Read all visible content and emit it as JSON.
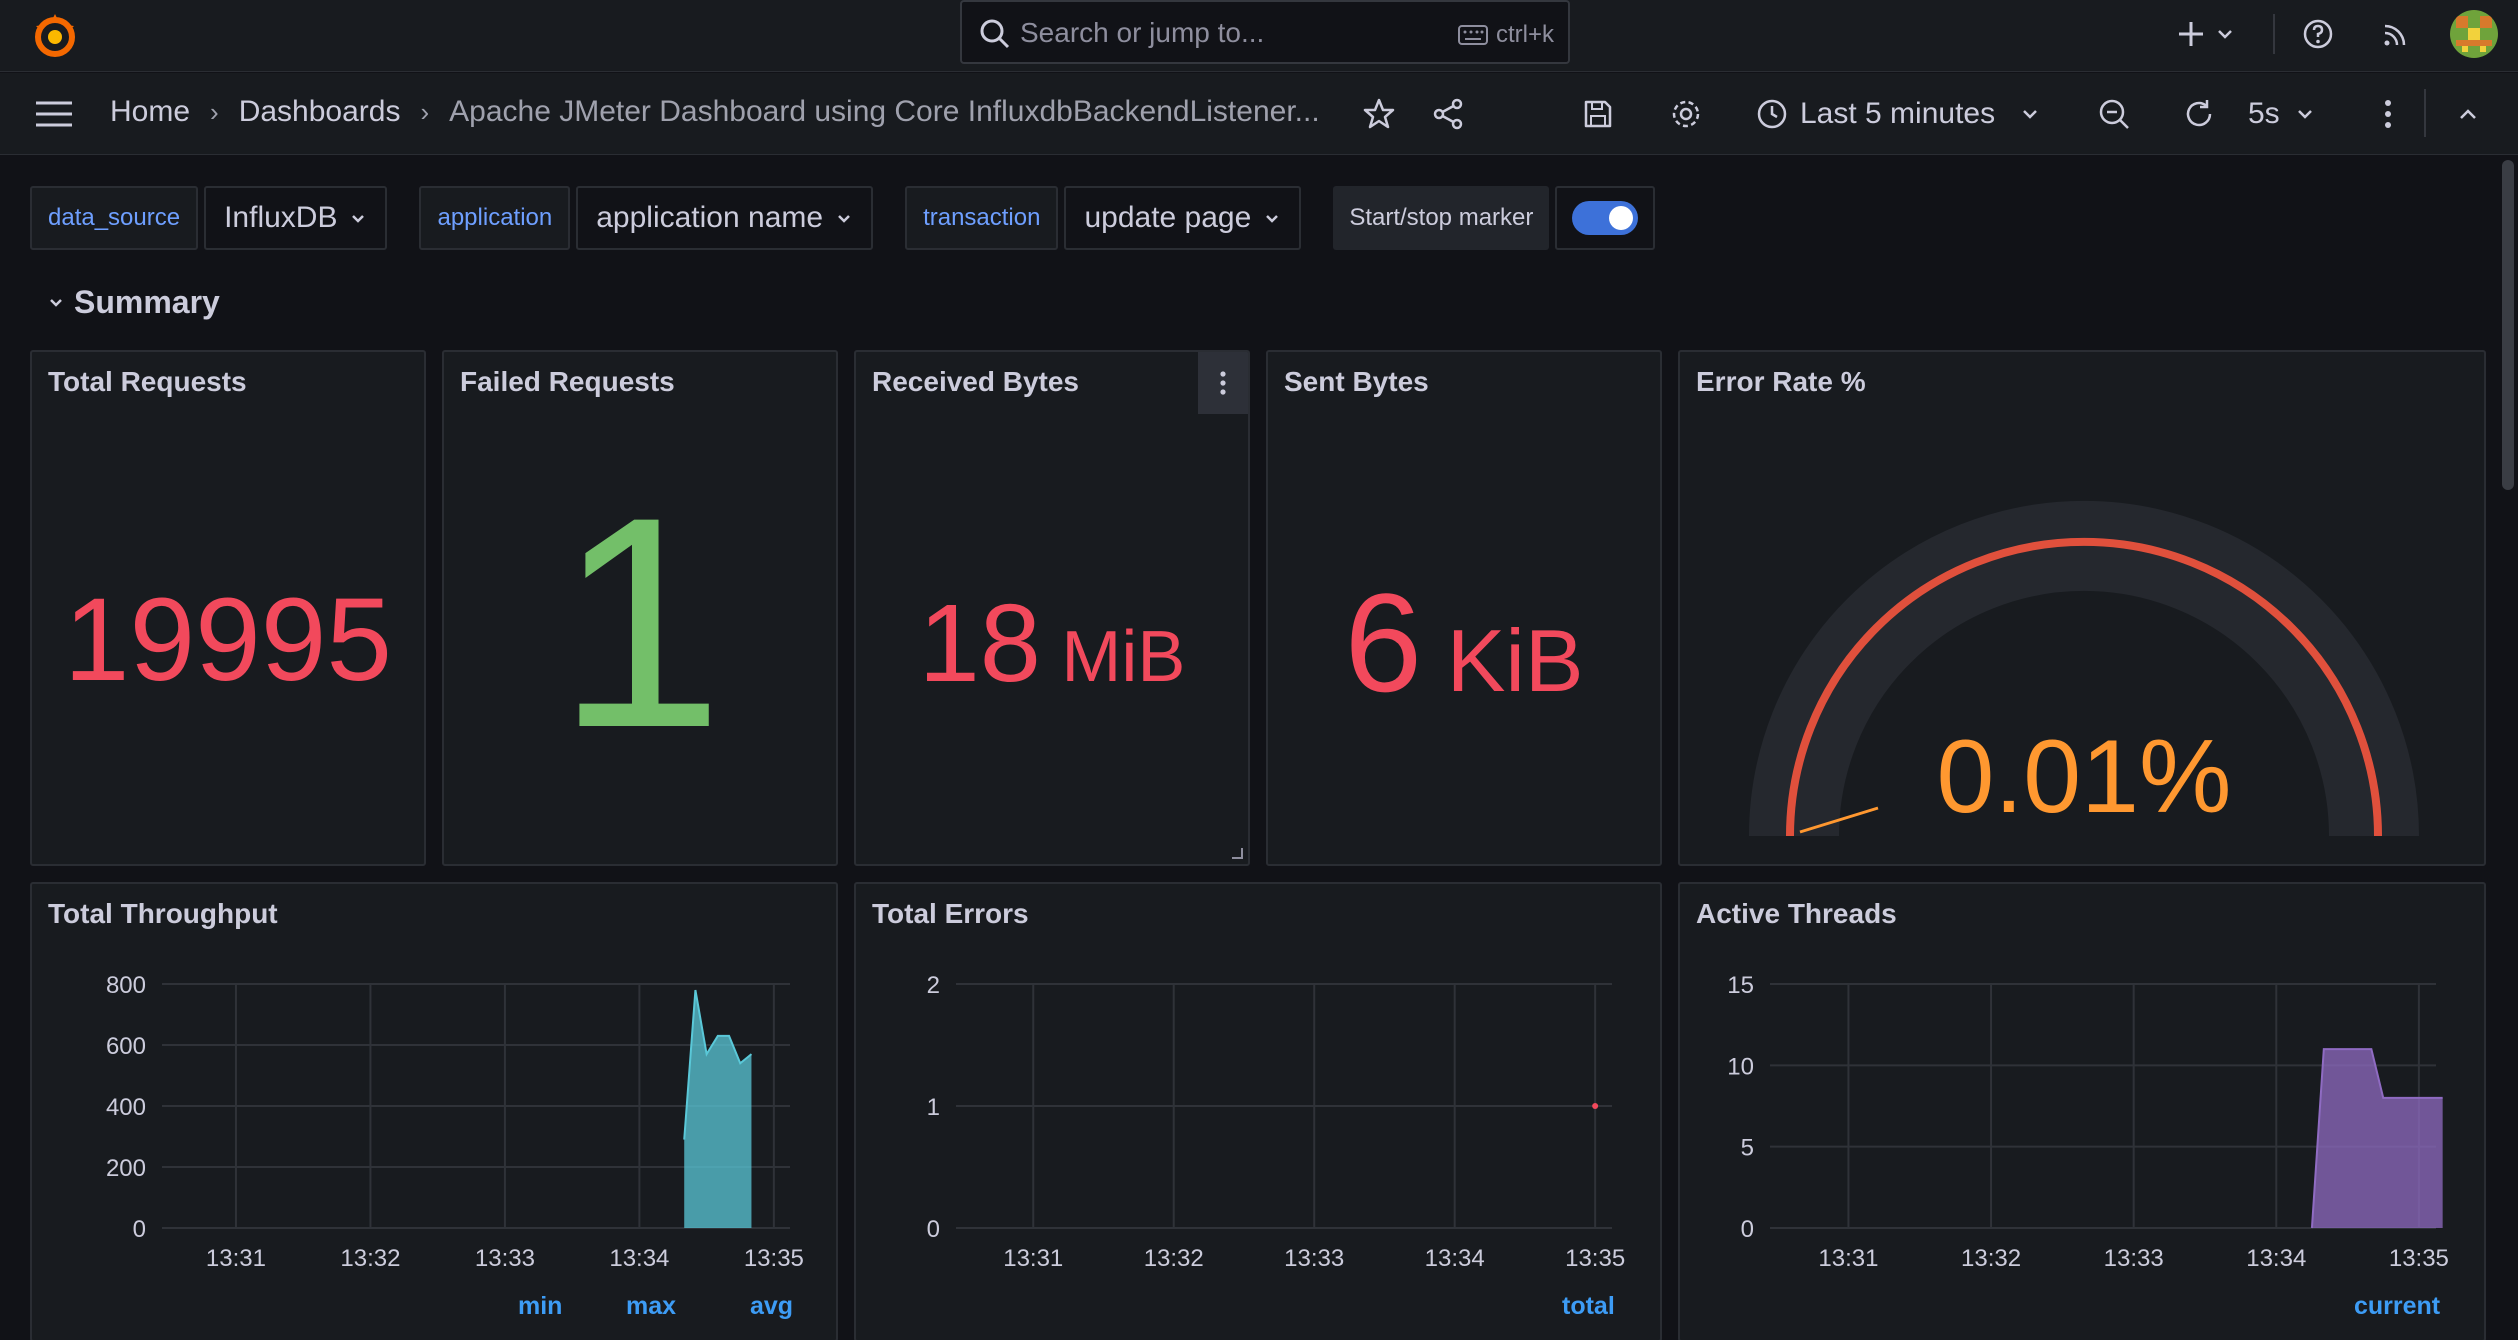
{
  "topbar": {
    "search_placeholder": "Search or jump to...",
    "search_shortcut": "ctrl+k",
    "icons": [
      "grafana-logo-icon",
      "search-icon",
      "keyboard-icon",
      "plus-icon",
      "help-icon",
      "news-icon",
      "avatar"
    ]
  },
  "nav": {
    "breadcrumbs": [
      "Home",
      "Dashboards",
      "Apache JMeter Dashboard using Core InfluxdbBackendListener..."
    ],
    "time_range": "Last 5 minutes",
    "refresh_interval": "5s"
  },
  "variables": {
    "data_source_label": "data_source",
    "data_source_value": "InfluxDB",
    "application_label": "application",
    "application_value": "application name",
    "transaction_label": "transaction",
    "transaction_value": "update page",
    "marker_label": "Start/stop marker",
    "marker_enabled": true
  },
  "row": {
    "title": "Summary"
  },
  "panels": {
    "total_requests": {
      "title": "Total Requests",
      "value": "19995",
      "color": "#f2495c"
    },
    "failed_requests": {
      "title": "Failed Requests",
      "value": "1",
      "color": "#73bf69"
    },
    "received_bytes": {
      "title": "Received Bytes",
      "value": "18",
      "unit": "MiB",
      "color": "#f2495c"
    },
    "sent_bytes": {
      "title": "Sent Bytes",
      "value": "6",
      "unit": "KiB",
      "color": "#f2495c"
    },
    "error_rate": {
      "title": "Error Rate %",
      "value": "0.01%",
      "color": "#ff9830",
      "gauge_color": "#f2495c"
    },
    "total_throughput": {
      "title": "Total Throughput",
      "legend": [
        "min",
        "max",
        "avg"
      ]
    },
    "total_errors": {
      "title": "Total Errors",
      "legend": [
        "total"
      ]
    },
    "active_threads": {
      "title": "Active Threads",
      "legend": [
        "current"
      ]
    }
  },
  "chart_data": [
    {
      "type": "area",
      "title": "Total Throughput",
      "x": [
        "13:31",
        "13:32",
        "13:33",
        "13:34",
        "13:35"
      ],
      "ylim": [
        0,
        800
      ],
      "yticks": [
        0,
        200,
        400,
        600,
        800
      ],
      "series": [
        {
          "points": [
            [
              "13:34:20",
              290
            ],
            [
              "13:34:25",
              780
            ],
            [
              "13:34:30",
              570
            ],
            [
              "13:34:35",
              630
            ],
            [
              "13:34:40",
              630
            ],
            [
              "13:34:45",
              540
            ],
            [
              "13:34:50",
              570
            ]
          ]
        }
      ],
      "color": "#5ac8d8"
    },
    {
      "type": "line",
      "title": "Total Errors",
      "x": [
        "13:31",
        "13:32",
        "13:33",
        "13:34",
        "13:35"
      ],
      "ylim": [
        0,
        2
      ],
      "yticks": [
        0,
        1,
        2
      ],
      "series": [
        {
          "points": [
            [
              "13:35",
              1
            ]
          ]
        }
      ],
      "color": "#f2495c"
    },
    {
      "type": "area",
      "title": "Active Threads",
      "x": [
        "13:31",
        "13:32",
        "13:33",
        "13:34",
        "13:35"
      ],
      "ylim": [
        0,
        15
      ],
      "yticks": [
        0,
        5,
        10,
        15
      ],
      "series": [
        {
          "points": [
            [
              "13:34:15",
              0
            ],
            [
              "13:34:20",
              11
            ],
            [
              "13:34:40",
              11
            ],
            [
              "13:34:45",
              8
            ],
            [
              "13:35:10",
              8
            ]
          ]
        }
      ],
      "color": "#8f6bc2"
    }
  ]
}
